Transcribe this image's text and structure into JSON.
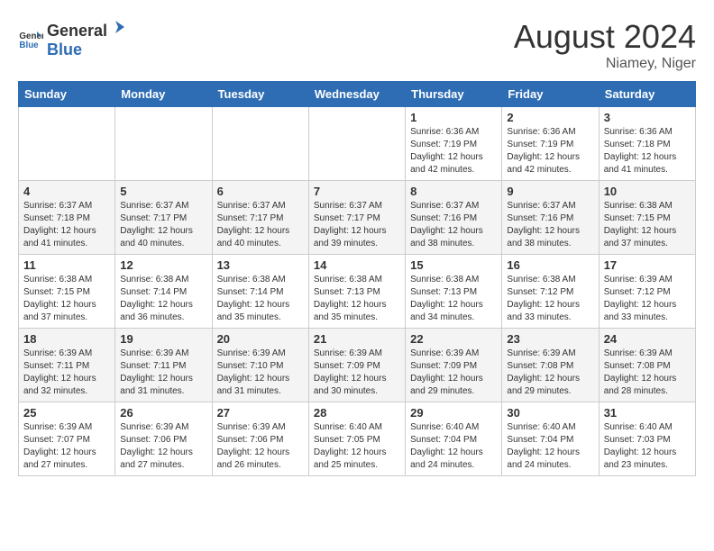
{
  "header": {
    "logo_general": "General",
    "logo_blue": "Blue",
    "month_year": "August 2024",
    "location": "Niamey, Niger"
  },
  "days_of_week": [
    "Sunday",
    "Monday",
    "Tuesday",
    "Wednesday",
    "Thursday",
    "Friday",
    "Saturday"
  ],
  "weeks": [
    [
      {
        "day": "",
        "info": ""
      },
      {
        "day": "",
        "info": ""
      },
      {
        "day": "",
        "info": ""
      },
      {
        "day": "",
        "info": ""
      },
      {
        "day": "1",
        "info": "Sunrise: 6:36 AM\nSunset: 7:19 PM\nDaylight: 12 hours and 42 minutes."
      },
      {
        "day": "2",
        "info": "Sunrise: 6:36 AM\nSunset: 7:19 PM\nDaylight: 12 hours and 42 minutes."
      },
      {
        "day": "3",
        "info": "Sunrise: 6:36 AM\nSunset: 7:18 PM\nDaylight: 12 hours and 41 minutes."
      }
    ],
    [
      {
        "day": "4",
        "info": "Sunrise: 6:37 AM\nSunset: 7:18 PM\nDaylight: 12 hours and 41 minutes."
      },
      {
        "day": "5",
        "info": "Sunrise: 6:37 AM\nSunset: 7:17 PM\nDaylight: 12 hours and 40 minutes."
      },
      {
        "day": "6",
        "info": "Sunrise: 6:37 AM\nSunset: 7:17 PM\nDaylight: 12 hours and 40 minutes."
      },
      {
        "day": "7",
        "info": "Sunrise: 6:37 AM\nSunset: 7:17 PM\nDaylight: 12 hours and 39 minutes."
      },
      {
        "day": "8",
        "info": "Sunrise: 6:37 AM\nSunset: 7:16 PM\nDaylight: 12 hours and 38 minutes."
      },
      {
        "day": "9",
        "info": "Sunrise: 6:37 AM\nSunset: 7:16 PM\nDaylight: 12 hours and 38 minutes."
      },
      {
        "day": "10",
        "info": "Sunrise: 6:38 AM\nSunset: 7:15 PM\nDaylight: 12 hours and 37 minutes."
      }
    ],
    [
      {
        "day": "11",
        "info": "Sunrise: 6:38 AM\nSunset: 7:15 PM\nDaylight: 12 hours and 37 minutes."
      },
      {
        "day": "12",
        "info": "Sunrise: 6:38 AM\nSunset: 7:14 PM\nDaylight: 12 hours and 36 minutes."
      },
      {
        "day": "13",
        "info": "Sunrise: 6:38 AM\nSunset: 7:14 PM\nDaylight: 12 hours and 35 minutes."
      },
      {
        "day": "14",
        "info": "Sunrise: 6:38 AM\nSunset: 7:13 PM\nDaylight: 12 hours and 35 minutes."
      },
      {
        "day": "15",
        "info": "Sunrise: 6:38 AM\nSunset: 7:13 PM\nDaylight: 12 hours and 34 minutes."
      },
      {
        "day": "16",
        "info": "Sunrise: 6:38 AM\nSunset: 7:12 PM\nDaylight: 12 hours and 33 minutes."
      },
      {
        "day": "17",
        "info": "Sunrise: 6:39 AM\nSunset: 7:12 PM\nDaylight: 12 hours and 33 minutes."
      }
    ],
    [
      {
        "day": "18",
        "info": "Sunrise: 6:39 AM\nSunset: 7:11 PM\nDaylight: 12 hours and 32 minutes."
      },
      {
        "day": "19",
        "info": "Sunrise: 6:39 AM\nSunset: 7:11 PM\nDaylight: 12 hours and 31 minutes."
      },
      {
        "day": "20",
        "info": "Sunrise: 6:39 AM\nSunset: 7:10 PM\nDaylight: 12 hours and 31 minutes."
      },
      {
        "day": "21",
        "info": "Sunrise: 6:39 AM\nSunset: 7:09 PM\nDaylight: 12 hours and 30 minutes."
      },
      {
        "day": "22",
        "info": "Sunrise: 6:39 AM\nSunset: 7:09 PM\nDaylight: 12 hours and 29 minutes."
      },
      {
        "day": "23",
        "info": "Sunrise: 6:39 AM\nSunset: 7:08 PM\nDaylight: 12 hours and 29 minutes."
      },
      {
        "day": "24",
        "info": "Sunrise: 6:39 AM\nSunset: 7:08 PM\nDaylight: 12 hours and 28 minutes."
      }
    ],
    [
      {
        "day": "25",
        "info": "Sunrise: 6:39 AM\nSunset: 7:07 PM\nDaylight: 12 hours and 27 minutes."
      },
      {
        "day": "26",
        "info": "Sunrise: 6:39 AM\nSunset: 7:06 PM\nDaylight: 12 hours and 27 minutes."
      },
      {
        "day": "27",
        "info": "Sunrise: 6:39 AM\nSunset: 7:06 PM\nDaylight: 12 hours and 26 minutes."
      },
      {
        "day": "28",
        "info": "Sunrise: 6:40 AM\nSunset: 7:05 PM\nDaylight: 12 hours and 25 minutes."
      },
      {
        "day": "29",
        "info": "Sunrise: 6:40 AM\nSunset: 7:04 PM\nDaylight: 12 hours and 24 minutes."
      },
      {
        "day": "30",
        "info": "Sunrise: 6:40 AM\nSunset: 7:04 PM\nDaylight: 12 hours and 24 minutes."
      },
      {
        "day": "31",
        "info": "Sunrise: 6:40 AM\nSunset: 7:03 PM\nDaylight: 12 hours and 23 minutes."
      }
    ]
  ]
}
